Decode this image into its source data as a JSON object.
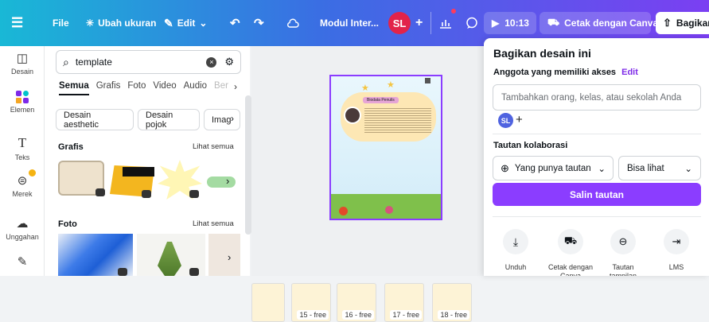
{
  "topbar": {
    "file": "File",
    "resize": "Ubah ukuran",
    "edit": "Edit",
    "title": "Modul Inter...",
    "avatar": "SL",
    "timer": "10:13",
    "print": "Cetak dengan Canva",
    "share": "Bagikan"
  },
  "sidebar": {
    "items": [
      {
        "label": "Desain",
        "icon": "layout-icon"
      },
      {
        "label": "Elemen",
        "icon": "elements-icon"
      },
      {
        "label": "Teks",
        "icon": "text-icon"
      },
      {
        "label": "Merek",
        "icon": "brand-icon"
      },
      {
        "label": "Unggahan",
        "icon": "upload-icon"
      }
    ]
  },
  "search": {
    "value": "template"
  },
  "tabs": [
    "Semua",
    "Grafis",
    "Foto",
    "Video",
    "Audio",
    "Ber"
  ],
  "chips": [
    "Desain aesthetic",
    "Desain pojok",
    "Imag"
  ],
  "sections": {
    "grafis": {
      "title": "Grafis",
      "see_all": "Lihat semua"
    },
    "foto": {
      "title": "Foto",
      "see_all": "Lihat semua"
    }
  },
  "page": {
    "badge": "Biodata Penulis"
  },
  "thumbs": [
    "15 - free",
    "16 - free",
    "17 - free",
    "18 - free"
  ],
  "share_panel": {
    "title": "Bagikan desain ini",
    "access_label": "Anggota yang memiliki akses",
    "edit_link": "Edit",
    "add_placeholder": "Tambahkan orang, kelas, atau sekolah Anda",
    "member_avatar": "SL",
    "collab_label": "Tautan kolaborasi",
    "link_access": "Yang punya tautan",
    "permission": "Bisa lihat",
    "copy_button": "Salin tautan",
    "actions": [
      {
        "label": "Unduh",
        "icon": "download-icon"
      },
      {
        "label": "Cetak dengan Canva",
        "icon": "truck-icon"
      },
      {
        "label": "Tautan tampilan",
        "icon": "link-icon"
      },
      {
        "label": "LMS",
        "icon": "lms-icon"
      }
    ]
  }
}
